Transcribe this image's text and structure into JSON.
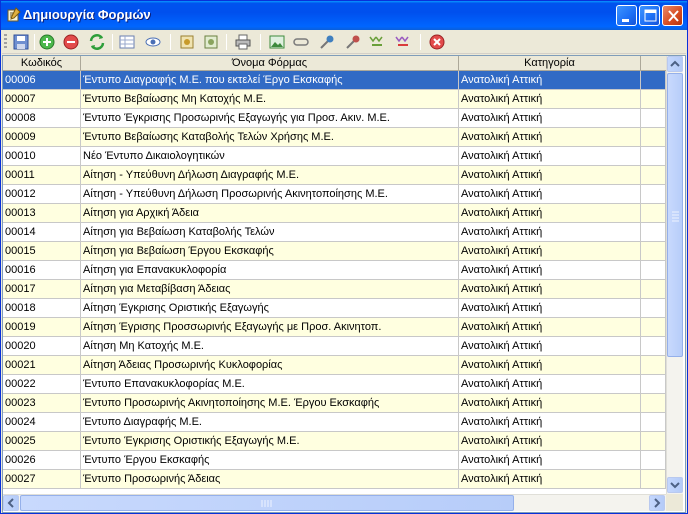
{
  "window": {
    "title": "Δημιουργία Φορμών"
  },
  "toolbar": {
    "buttons": [
      {
        "name": "save-icon",
        "color": "#4a6fb5"
      },
      {
        "name": "add-icon",
        "color": "#3fa33f"
      },
      {
        "name": "remove-icon",
        "color": "#d93c3c"
      },
      {
        "name": "refresh-icon",
        "color": "#2e9e3a"
      },
      {
        "name": "grid-view-icon",
        "color": "#6a7fb0"
      },
      {
        "name": "preview-icon",
        "color": "#4a6fb5"
      },
      {
        "name": "settings-icon",
        "color": "#c89b2a"
      },
      {
        "name": "settings-alt-icon",
        "color": "#8aa35e"
      },
      {
        "name": "print-icon",
        "color": "#6b6b6b"
      },
      {
        "name": "image-icon",
        "color": "#3d8a3d"
      },
      {
        "name": "link-icon",
        "color": "#7a7a7a"
      },
      {
        "name": "tool-icon",
        "color": "#3f7fbf"
      },
      {
        "name": "tool-alt-icon",
        "color": "#c0504d"
      },
      {
        "name": "filter-icon",
        "color": "#6a9f3a"
      },
      {
        "name": "filter-alt-icon",
        "color": "#9a5ac0"
      },
      {
        "name": "cancel-icon",
        "color": "#d93c3c"
      }
    ]
  },
  "grid": {
    "columns": [
      "Κωδικός",
      "Όνομα Φόρμας",
      "Κατηγορία"
    ],
    "rows": [
      {
        "code": "00006",
        "name": "Έντυπο Διαγραφής Μ.Ε. που εκτελεί Έργο Εκσκαφής",
        "category": "Ανατολική Αττική",
        "selected": true
      },
      {
        "code": "00007",
        "name": "Έντυπο Βεβαίωσης Μη Κατοχής Μ.Ε.",
        "category": "Ανατολική Αττική"
      },
      {
        "code": "00008",
        "name": "Έντυπο Έγκρισης Προσωρινής Εξαγωγής για Προσ. Ακιν. Μ.Ε.",
        "category": "Ανατολική Αττική"
      },
      {
        "code": "00009",
        "name": "Έντυπο Βεβαίωσης Καταβολής Τελών Χρήσης Μ.Ε.",
        "category": "Ανατολική Αττική"
      },
      {
        "code": "00010",
        "name": "Νέο Έντυπο Δικαιολογητικών",
        "category": "Ανατολική Αττική"
      },
      {
        "code": "00011",
        "name": "Αίτηση - Υπεύθυνη Δήλωση Διαγραφής Μ.Ε.",
        "category": "Ανατολική Αττική"
      },
      {
        "code": "00012",
        "name": "Αίτηση - Υπεύθυνη Δήλωση Προσωρινής Ακινητοποίησης Μ.Ε.",
        "category": "Ανατολική Αττική"
      },
      {
        "code": "00013",
        "name": "Αίτηση για Αρχική Άδεια",
        "category": "Ανατολική Αττική"
      },
      {
        "code": "00014",
        "name": "Αίτηση για Βεβαίωση Καταβολής Τελών",
        "category": "Ανατολική Αττική"
      },
      {
        "code": "00015",
        "name": "Αίτηση για Βεβαίωση Έργου Εκσκαφής",
        "category": "Ανατολική Αττική"
      },
      {
        "code": "00016",
        "name": "Αίτηση για Επανακυκλοφορία",
        "category": "Ανατολική Αττική"
      },
      {
        "code": "00017",
        "name": "Αίτηση για Μεταβίβαση Άδειας",
        "category": "Ανατολική Αττική"
      },
      {
        "code": "00018",
        "name": "Αίτηση Έγκρισης Οριστικής Εξαγωγής",
        "category": "Ανατολική Αττική"
      },
      {
        "code": "00019",
        "name": "Αίτηση Έγρισης Προσσωρινής Εξαγωγής με Προσ. Ακινητοπ.",
        "category": "Ανατολική Αττική"
      },
      {
        "code": "00020",
        "name": "Αίτηση Μη Κατοχής Μ.Ε.",
        "category": "Ανατολική Αττική"
      },
      {
        "code": "00021",
        "name": "Αίτηση Άδειας Προσωρινής Κυκλοφορίας",
        "category": "Ανατολική Αττική"
      },
      {
        "code": "00022",
        "name": "Έντυπο Επανακυκλοφορίας Μ.Ε.",
        "category": "Ανατολική Αττική"
      },
      {
        "code": "00023",
        "name": "Έντυπο Προσωρινής Ακινητοποίησης Μ.Ε. Έργου Εκσκαφής",
        "category": "Ανατολική Αττική"
      },
      {
        "code": "00024",
        "name": "Έντυπο Διαγραφής Μ.Ε.",
        "category": "Ανατολική Αττική"
      },
      {
        "code": "00025",
        "name": "Έντυπο Έγκρισης Οριστικής Εξαγωγής Μ.Ε.",
        "category": "Ανατολική Αττική"
      },
      {
        "code": "00026",
        "name": "Έντυπο Έργου Εκσκαφής",
        "category": "Ανατολική Αττική"
      },
      {
        "code": "00027",
        "name": "Έντυπο Προσωρινής Άδειας",
        "category": "Ανατολική Αττική"
      }
    ]
  }
}
